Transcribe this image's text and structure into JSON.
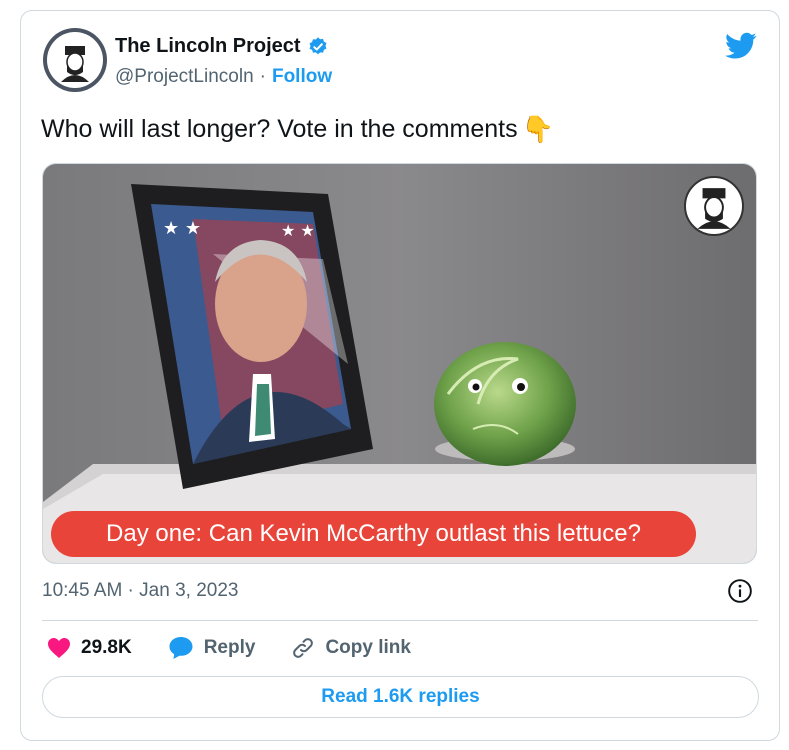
{
  "author": {
    "name": "The Lincoln Project",
    "handle": "@ProjectLincoln",
    "separator": "·",
    "follow_label": "Follow"
  },
  "tweet": {
    "text": "Who will last longer? Vote in the comments",
    "emoji": "👇"
  },
  "media": {
    "caption": "Day one: Can Kevin McCarthy outlast this lettuce?"
  },
  "meta": {
    "timestamp": "10:45 AM · Jan 3, 2023"
  },
  "actions": {
    "likes": "29.8K",
    "reply_label": "Reply",
    "copy_link_label": "Copy link"
  },
  "read_replies_label": "Read 1.6K replies",
  "colors": {
    "accent": "#1d9bf0",
    "like": "#f91880",
    "caption_bg": "#e8443a"
  }
}
